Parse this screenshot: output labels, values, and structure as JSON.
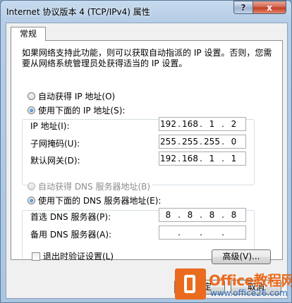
{
  "window": {
    "title": "Internet 协议版本 4 (TCP/IPv4) 属性",
    "help_label": "?",
    "close_label": "x"
  },
  "tabs": [
    {
      "label": "常规",
      "selected": true
    }
  ],
  "description": "如果网络支持此功能，则可以获取自动指派的 IP 设置。否则，您需要从网络系统管理员处获得适当的 IP 设置。",
  "ip": {
    "auto_label": "自动获得 IP 地址(O)",
    "auto_selected": false,
    "manual_label": "使用下面的 IP 地址(S):",
    "manual_selected": true,
    "fields": [
      {
        "label": "IP 地址(I):",
        "octets": [
          "192",
          "168",
          "1",
          "2"
        ]
      },
      {
        "label": "子网掩码(U):",
        "octets": [
          "255",
          "255",
          "255",
          "0"
        ]
      },
      {
        "label": "默认网关(D):",
        "octets": [
          "192",
          "168",
          "1",
          "1"
        ]
      }
    ]
  },
  "dns": {
    "auto_label": "自动获得 DNS 服务器地址(B)",
    "auto_enabled": false,
    "manual_label": "使用下面的 DNS 服务器地址(E):",
    "manual_selected": true,
    "fields": [
      {
        "label": "首选 DNS 服务器(P):",
        "octets": [
          "8",
          "8",
          "8",
          "8"
        ]
      },
      {
        "label": "备用 DNS 服务器(A):",
        "octets": [
          "",
          "",
          "",
          ""
        ]
      }
    ]
  },
  "validate_on_exit": {
    "label": "退出时验证设置(L)",
    "checked": false
  },
  "advanced_button": "高级(V)...",
  "footer_buttons": {
    "ok_partial": "定",
    "cancel": "取消"
  },
  "watermark": {
    "title": "Office教程网",
    "url": "www.office26.com",
    "accent": "#eb6b1e"
  }
}
